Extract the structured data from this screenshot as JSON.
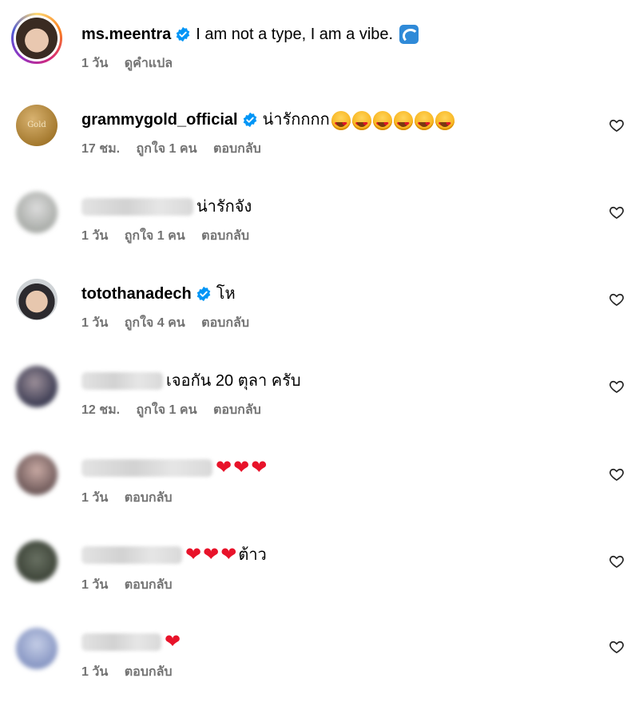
{
  "post": {
    "username": "ms.meentra",
    "caption": "I am not a type, I am a vibe.",
    "caption_emoji": "wave-emoji",
    "time": "1 วัน",
    "translate_label": "ดูคำแปล"
  },
  "labels": {
    "like_count_prefix": "ถูกใจ",
    "reply": "ตอบกลับ"
  },
  "comments": [
    {
      "username": "grammygold_official",
      "verified": true,
      "text": "น่ารักกกก",
      "emoji": "heart-eyes-face-emoji x6",
      "time": "17 ชม.",
      "likes": "ถูกใจ 1 คน",
      "reply": "ตอบกลับ"
    },
    {
      "username": "",
      "verified": false,
      "text": "น่ารักจัง",
      "time": "1 วัน",
      "likes": "ถูกใจ 1 คน",
      "reply": "ตอบกลับ"
    },
    {
      "username": "totothanadech",
      "verified": true,
      "text": "โห",
      "time": "1 วัน",
      "likes": "ถูกใจ 4 คน",
      "reply": "ตอบกลับ"
    },
    {
      "username": "",
      "verified": false,
      "text": "เจอกัน 20 ตุลา ครับ",
      "time": "12 ชม.",
      "likes": "ถูกใจ 1 คน",
      "reply": "ตอบกลับ"
    },
    {
      "username": "",
      "verified": false,
      "text": "",
      "emoji": "red-heart-emoji x3",
      "time": "1 วัน",
      "reply": "ตอบกลับ"
    },
    {
      "username": "",
      "verified": false,
      "text": "ต้าว",
      "emoji": "red-heart-emoji x3",
      "time": "1 วัน",
      "reply": "ตอบกลับ"
    },
    {
      "username": "",
      "verified": false,
      "text": "",
      "emoji": "red-heart-emoji x1",
      "time": "1 วัน",
      "reply": "ตอบกลับ"
    }
  ],
  "colors": {
    "meta_text": "#737373",
    "verified_blue": "#0095f6",
    "heart_red": "#e8132a",
    "story_ring": "#d62976"
  }
}
